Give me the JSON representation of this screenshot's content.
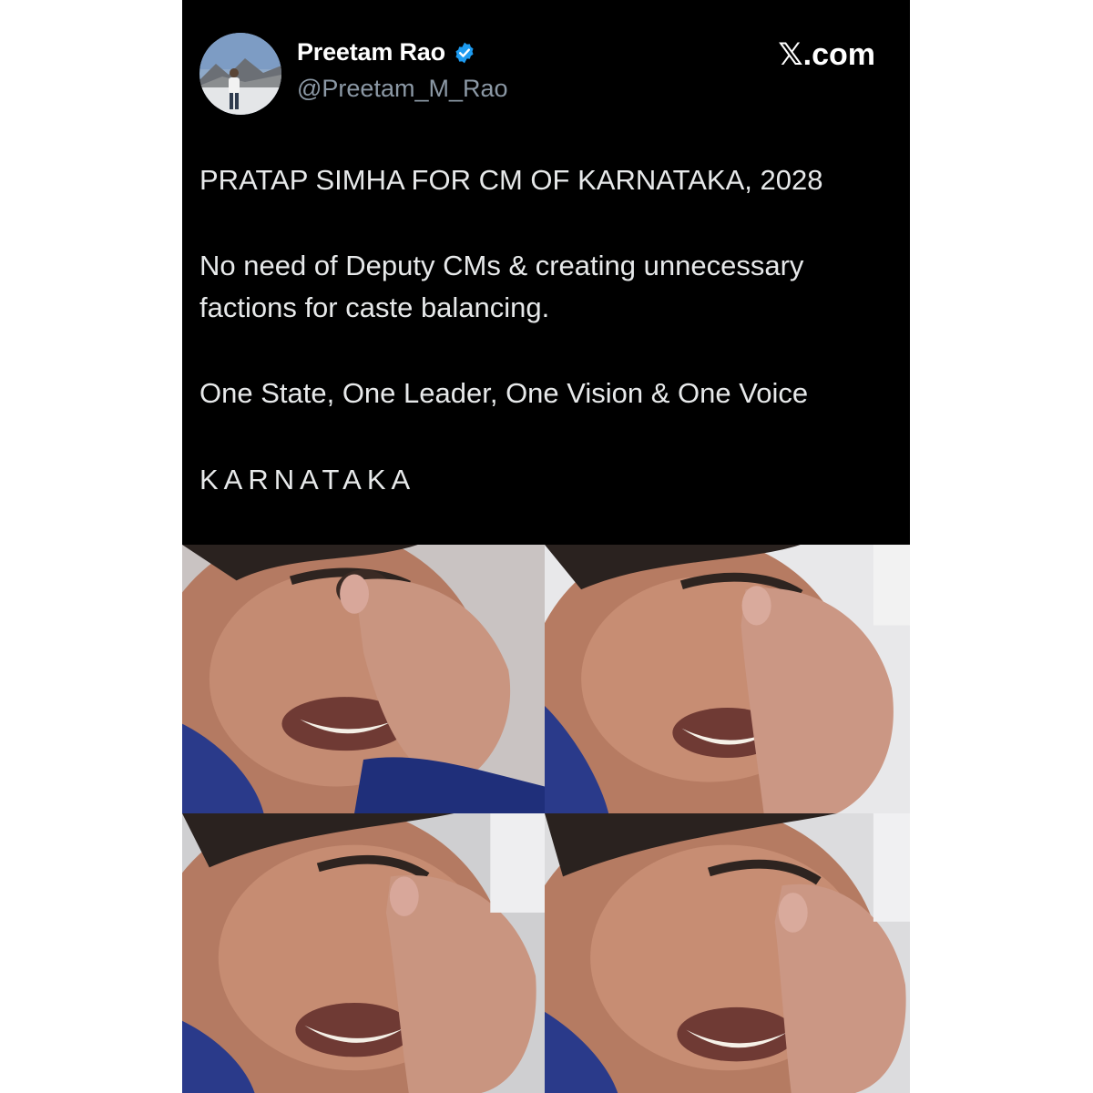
{
  "author": {
    "display_name": "Preetam Rao",
    "handle": "@Preetam_M_Rao",
    "verified": true,
    "avatar_icon": "avatar-photo"
  },
  "brand": {
    "label": ".com",
    "icon": "x-logo-icon"
  },
  "tweet": {
    "line1": "PRATAP SIMHA FOR CM OF KARNATAKA, 2028",
    "line2": "No need of Deputy CMs & creating unnecessary factions for caste balancing.",
    "line3": "One State, One Leader, One Vision & One Voice",
    "line4": "KARNATAKA"
  },
  "media": {
    "panels": [
      {
        "icon": "crying-man-image"
      },
      {
        "icon": "crying-man-image"
      },
      {
        "icon": "crying-man-image"
      },
      {
        "icon": "crying-man-image"
      }
    ]
  },
  "colors": {
    "background": "#000000",
    "text": "#e7e9ea",
    "secondary": "#8b98a5",
    "verified": "#1d9bf0"
  }
}
